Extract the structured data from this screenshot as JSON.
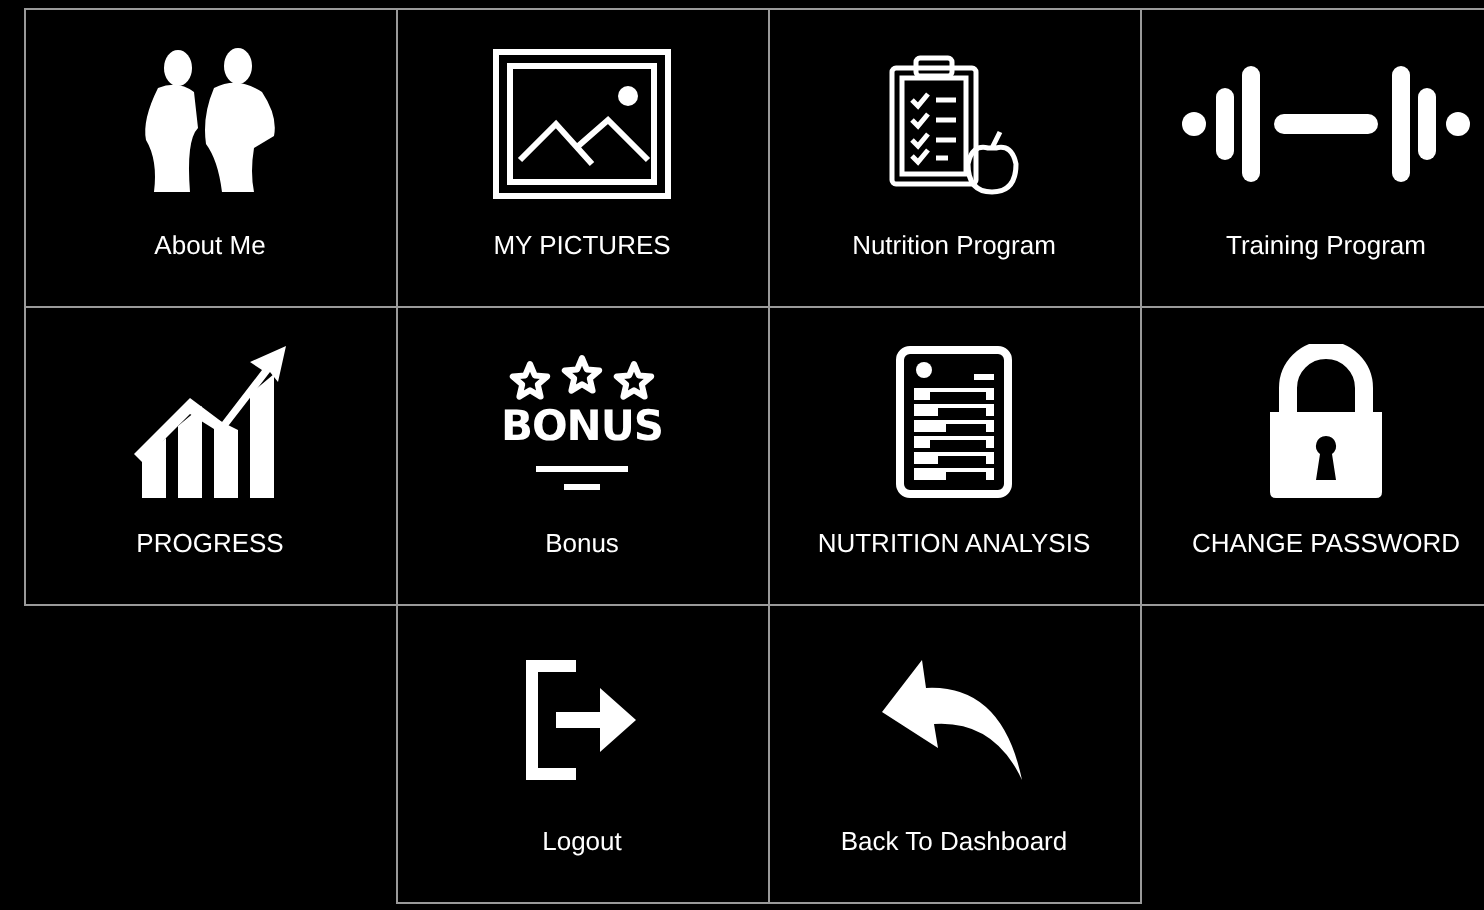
{
  "rows": [
    {
      "tiles": [
        {
          "kind": "people",
          "label": "About Me"
        },
        {
          "kind": "pictures",
          "label": "MY PICTURES"
        },
        {
          "kind": "nutrition",
          "label": "Nutrition Program"
        },
        {
          "kind": "dumbbell",
          "label": "Training Program"
        }
      ]
    },
    {
      "tiles": [
        {
          "kind": "progress",
          "label": "PROGRESS"
        },
        {
          "kind": "bonus",
          "label": "Bonus",
          "icon_text": "BONUS"
        },
        {
          "kind": "analysis",
          "label": "NUTRITION ANALYSIS"
        },
        {
          "kind": "lock",
          "label": "CHANGE PASSWORD"
        }
      ]
    },
    {
      "tiles": [
        {
          "kind": "logout",
          "label": "Logout"
        },
        {
          "kind": "back",
          "label": "Back To Dashboard"
        }
      ]
    }
  ]
}
